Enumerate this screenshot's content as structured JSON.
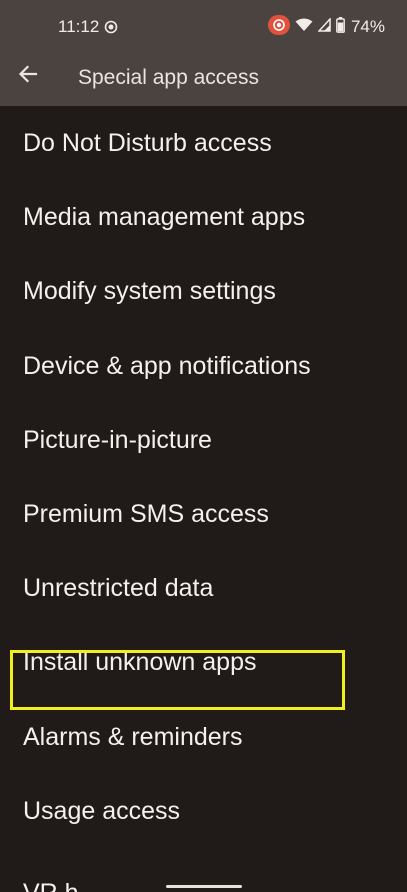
{
  "status_bar": {
    "time": "11:12",
    "battery_percent": "74%",
    "icons": [
      "screen-record-icon",
      "recording-indicator-icon",
      "wifi-icon",
      "cellular-signal-icon",
      "battery-icon"
    ]
  },
  "app_bar": {
    "back_icon": "arrow-back-icon",
    "title": "Special app access"
  },
  "items": [
    {
      "label": "Do Not Disturb access"
    },
    {
      "label": "Media management apps"
    },
    {
      "label": "Modify system settings"
    },
    {
      "label": "Device & app notifications"
    },
    {
      "label": "Picture-in-picture"
    },
    {
      "label": "Premium SMS access"
    },
    {
      "label": "Unrestricted data"
    },
    {
      "label": "Install unknown apps"
    },
    {
      "label": "Alarms & reminders"
    },
    {
      "label": "Usage access"
    }
  ],
  "partial_item": {
    "label": "VR h"
  },
  "highlight": {
    "item_label": "Install unknown apps",
    "color": "#f2f01c"
  },
  "colors": {
    "background": "#201a18",
    "app_bar": "#4a4340",
    "text": "#f5f0ed",
    "recording_badge": "#e0523e"
  }
}
